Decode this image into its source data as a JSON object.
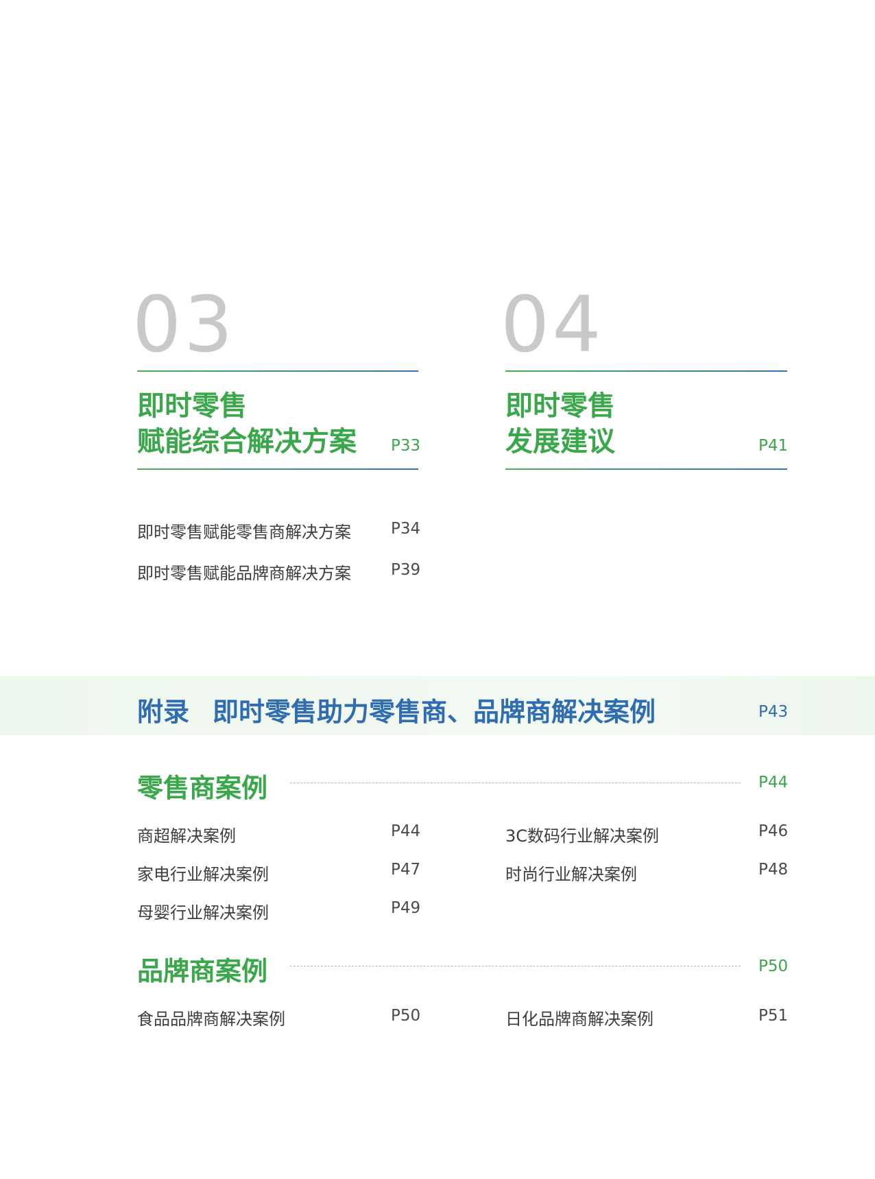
{
  "sections": [
    {
      "number": "03",
      "title_line1": "即时零售",
      "title_line2": "赋能综合解决方案",
      "page": "P33",
      "items": [
        {
          "label": "即时零售赋能零售商解决方案",
          "page": "P34"
        },
        {
          "label": "即时零售赋能品牌商解决方案",
          "page": "P39"
        }
      ]
    },
    {
      "number": "04",
      "title_line1": "即时零售",
      "title_line2": "发展建议",
      "page": "P41"
    }
  ],
  "appendix": {
    "label": "附录",
    "title": "即时零售助力零售商、品牌商解决案例",
    "page": "P43"
  },
  "retailer_cases": {
    "title": "零售商案例",
    "page": "P44",
    "items": [
      {
        "label": "商超解决案例",
        "page": "P44"
      },
      {
        "label": "3C数码行业解决案例",
        "page": "P46"
      },
      {
        "label": "家电行业解决案例",
        "page": "P47"
      },
      {
        "label": "时尚行业解决案例",
        "page": "P48"
      },
      {
        "label": "母婴行业解决案例",
        "page": "P49"
      }
    ]
  },
  "brand_cases": {
    "title": "品牌商案例",
    "page": "P50",
    "items": [
      {
        "label": "食品品牌商解决案例",
        "page": "P50"
      },
      {
        "label": "日化品牌商解决案例",
        "page": "P51"
      }
    ]
  },
  "colors": {
    "green": "#3aa74a",
    "blue": "#2f6db0",
    "number_gray": "#c9c9c9"
  }
}
